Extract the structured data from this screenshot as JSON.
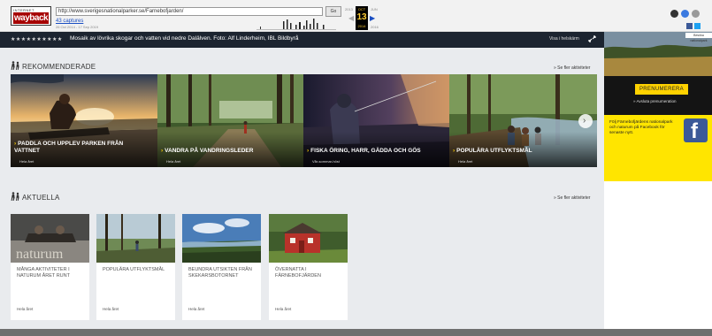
{
  "wayback": {
    "logo_top": "INTERNET ARCHIVE",
    "logo_word": "wayback",
    "url": "http://www.sverigesnationalparker.se/Farnebofjarden/",
    "go_label": "Go",
    "captures_label": "43 captures",
    "range_label": "26 Oct 2014 - 17 Sep 2019",
    "prev_year": "2013",
    "month": "OCT",
    "day": "13",
    "year": "2014",
    "next_year_top": "JUN",
    "next_year": "2016"
  },
  "caption": {
    "dots": "★★★★★★★★★★",
    "text": "Mosaik av lövrika skogar och vatten vid nedre Dalälven. Foto: Alf Linderheim, IBL Bildbyrå",
    "fullscreen_label": "Visa i helskärm"
  },
  "recommended": {
    "title": "REKOMMENDERADE",
    "more": "» Se fler aktiviteter",
    "cards": [
      {
        "title": "PADDLA OCH UPPLEV PARKEN FRÅN VATTNET",
        "sub": "Hela året"
      },
      {
        "title": "VANDRA PÅ VANDRINGSLEDER",
        "sub": "Hela året"
      },
      {
        "title": "FISKA ÖRING, HARR, GÄDDA OCH GÖS",
        "sub": "Vår-sommar-höst"
      },
      {
        "title": "POPULÄRA UTFLYKTSMÅL",
        "sub": "Hela året"
      }
    ]
  },
  "current": {
    "title": "AKTUELLA",
    "more": "» Se fler aktiviteter",
    "cards": [
      {
        "title": "MÅNGA AKTIVITETER I NATURUM ÅRET RUNT",
        "sub": "Hela året",
        "image_text": "naturum"
      },
      {
        "title": "POPULÄRA UTFLYKTSMÅL",
        "sub": "Hela året"
      },
      {
        "title": "BEUNDRA UTSIKTEN FRÅN SKEKARSBOTORNET",
        "sub": "Hela året"
      },
      {
        "title": "ÖVERNATTA I FÄRNEBOFJÄRDEN",
        "sub": "Hela året"
      }
    ]
  },
  "sidebar": {
    "search_label": "Besöka nationalpark",
    "subscribe_label": "PRENUMERERA",
    "unsubscribe_label": "» Avsluta prenumeration",
    "facebook_text": "Följ Färnebofjärdens nationalpark och naturum på Facebook för senaste nytt.",
    "facebook_logo": "f"
  },
  "colors": {
    "accent_yellow": "#ffd200",
    "caption_bg": "#1c2430",
    "facebook_blue": "#3b5998"
  }
}
